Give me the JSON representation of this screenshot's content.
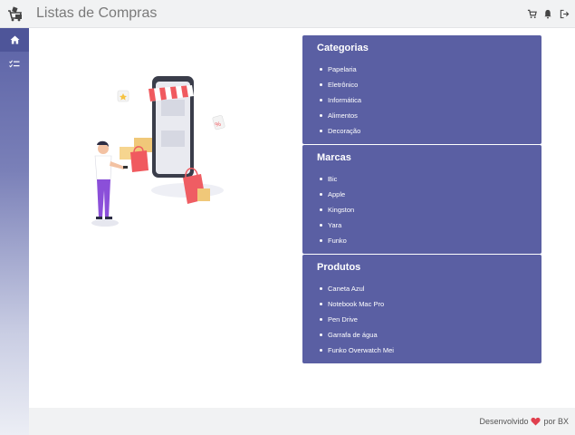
{
  "header": {
    "title": "Listas de Compras",
    "icons": [
      "cart-icon",
      "bell-icon",
      "logout-icon"
    ]
  },
  "sidebar": {
    "items": [
      {
        "icon": "home-icon",
        "active": true
      },
      {
        "icon": "checklist-icon",
        "active": false
      }
    ]
  },
  "cards": {
    "categorias": {
      "title": "Categorias",
      "items": [
        "Papelaria",
        "Eletrônico",
        "Informática",
        "Alimentos",
        "Decoração"
      ]
    },
    "marcas": {
      "title": "Marcas",
      "items": [
        "Bic",
        "Apple",
        "Kingston",
        "Yara",
        "Funko"
      ]
    },
    "produtos": {
      "title": "Produtos",
      "items": [
        "Caneta Azul",
        "Notebook Mac Pro",
        "Pen Drive",
        "Garrafa de água",
        "Funko Overwatch Mei"
      ]
    }
  },
  "footer": {
    "prefix": "Desenvolvido",
    "suffix": "por BX"
  },
  "colors": {
    "accent": "#5a5fa3",
    "heart": "#e0404e"
  }
}
